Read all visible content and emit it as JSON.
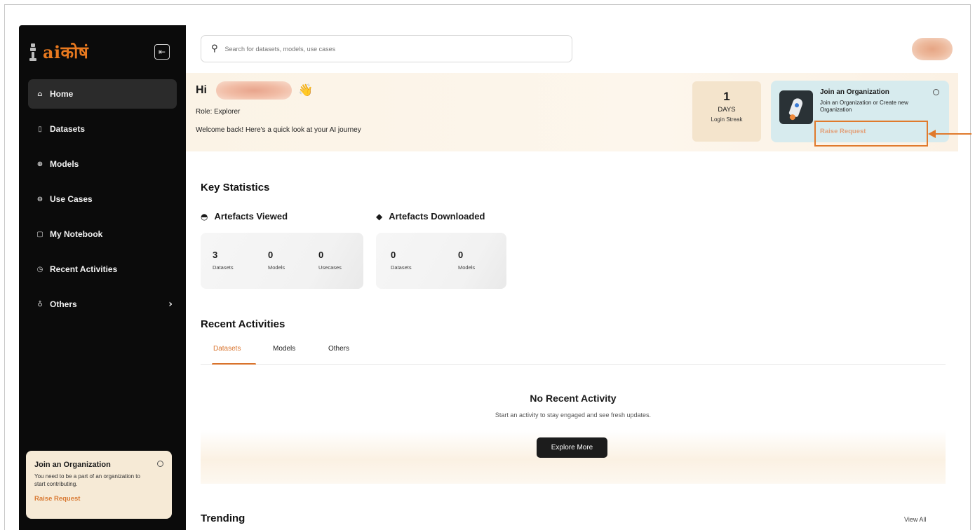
{
  "sidebar": {
    "logo_text_ai": "ai",
    "logo_text_rest": "कोषं",
    "items": [
      {
        "label": "Home",
        "icon": "home-icon"
      },
      {
        "label": "Datasets",
        "icon": "database-icon"
      },
      {
        "label": "Models",
        "icon": "model-icon"
      },
      {
        "label": "Use Cases",
        "icon": "briefcase-icon"
      },
      {
        "label": "My Notebook",
        "icon": "notebook-icon"
      },
      {
        "label": "Recent Activities",
        "icon": "clock-icon"
      },
      {
        "label": "Others",
        "icon": "bulb-icon"
      }
    ],
    "org_card": {
      "title": "Join an Organization",
      "text": "You need to be a part of an organization to start contributing.",
      "link": "Raise Request"
    }
  },
  "search": {
    "placeholder": "Search for datasets, models, use cases"
  },
  "hero": {
    "greeting": "Hi",
    "role": "Role: Explorer",
    "welcome": "Welcome back! Here's a quick look at your AI journey",
    "streak": {
      "value": "1",
      "unit": "DAYS",
      "label": "Login Streak"
    },
    "org_card": {
      "title": "Join an Organization",
      "text": "Join an Organization or Create new Organization",
      "link": "Raise Request"
    }
  },
  "stats": {
    "title": "Key Statistics",
    "viewed": {
      "title": "Artefacts Viewed",
      "items": [
        {
          "value": "3",
          "label": "Datasets"
        },
        {
          "value": "0",
          "label": "Models"
        },
        {
          "value": "0",
          "label": "Usecases"
        }
      ]
    },
    "downloaded": {
      "title": "Artefacts Downloaded",
      "items": [
        {
          "value": "0",
          "label": "Datasets"
        },
        {
          "value": "0",
          "label": "Models"
        }
      ]
    }
  },
  "recent": {
    "title": "Recent Activities",
    "tabs": [
      "Datasets",
      "Models",
      "Others"
    ],
    "empty_title": "No Recent Activity",
    "empty_text": "Start an activity to stay engaged and see fresh updates.",
    "button": "Explore More"
  },
  "trending": {
    "title": "Trending",
    "view_all": "View All"
  },
  "colors": {
    "accent": "#d9732c",
    "sidebar_bg": "#0b0b0b"
  }
}
